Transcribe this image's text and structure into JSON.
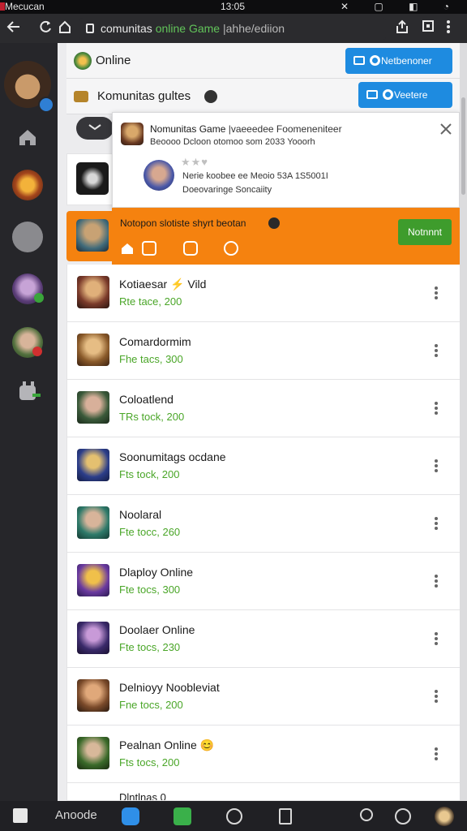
{
  "status_bar": {
    "carrier": "Mecucan",
    "time": "13:05",
    "icons": "✕ ▢ ◧ ◔"
  },
  "url_bar": {
    "back_icon": "arrow-left-icon",
    "url_part1": "comunitas ",
    "url_part2": "online Game",
    "url_part3": " |ahhe/ediion"
  },
  "header": {
    "online_label": "Online",
    "community_label": "Komunitas gultes",
    "btn1_label": "Netbenoner",
    "btn2_label": "Veetere"
  },
  "popup": {
    "title": "Nomunitas Game",
    "title_suffix": " |vaeeedee Foomeneniteer",
    "subtitle": "Beoooo Dcloon otomoo som 2033 Yooorh",
    "rating": "★★♥",
    "info1": "Nerie koobee ee Meoio 53A 1S5001I",
    "info2": "Doeovaringe Soncaiity",
    "banner_text": "Notopon slotiste shyrt beotan",
    "action_label": "Notnnnt",
    "colors": {
      "orange": "#f5820f",
      "green": "#4aa628",
      "blue": "#1e8be0"
    }
  },
  "list": [
    {
      "title": "Kotiaesar ⚡ Vild",
      "sub": "Rte tace, 200"
    },
    {
      "title": "Comardormim",
      "sub": "Fhe tacs, 300"
    },
    {
      "title": "Coloatlend",
      "sub": "TRs tock, 200"
    },
    {
      "title": "Soonumitags ocdane",
      "sub": "Fts tock, 200"
    },
    {
      "title": "Noolaral",
      "sub": "Fte tocc, 260"
    },
    {
      "title": "Dlaploy Online",
      "sub": "Fte tocs, 300"
    },
    {
      "title": "Doolaer Online",
      "sub": "Fte tocs, 230"
    },
    {
      "title": "Delnioyy Noobleviat",
      "sub": "Fne tocs, 200"
    },
    {
      "title": "Pealnan Online 😊",
      "sub": "Fts tocs, 200"
    },
    {
      "title": "Dlntlnas 0",
      "sub": ""
    }
  ],
  "bottom_bar": {
    "text_label": "Anoode"
  }
}
